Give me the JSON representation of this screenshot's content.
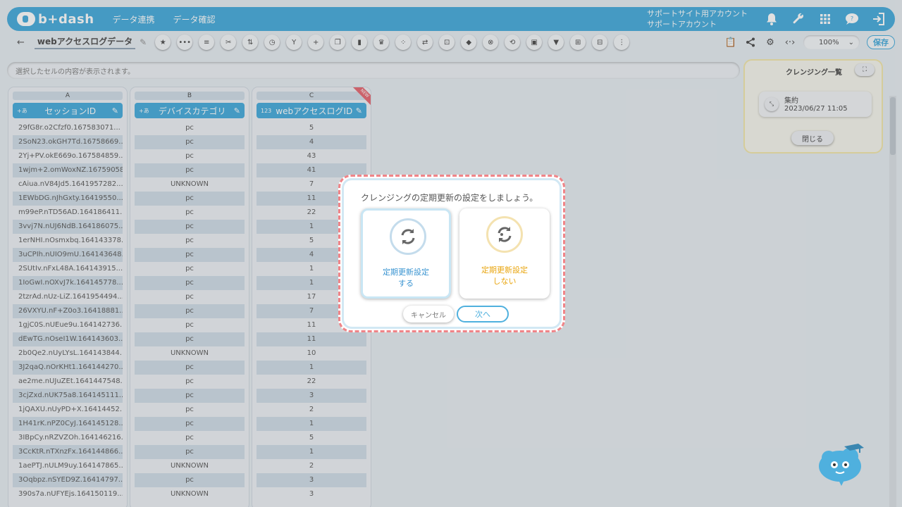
{
  "header": {
    "logo": "b+dash",
    "nav": [
      "データ連携",
      "データ確認"
    ],
    "account_line1": "サポートサイト用アカウント",
    "account_line2": "サポートアカウント",
    "icons": [
      "bell-icon",
      "wrench-icon",
      "grid-icon",
      "chat-icon",
      "logout-icon"
    ]
  },
  "toolbar": {
    "back": "←",
    "doc_name": "webアクセスログデータ",
    "tool_icons": [
      "star-icon",
      "dots-icon",
      "list-icon",
      "scissors-icon",
      "split-icon",
      "timer-icon",
      "merge-icon",
      "plus-icon",
      "copy-icon",
      "trash-icon",
      "crown-icon",
      "move-icon",
      "replace-icon",
      "lock-icon",
      "cube-icon",
      "cancel-circle-icon",
      "convert-icon",
      "frame-icon",
      "filter-icon",
      "pivot-icon",
      "table-icon",
      "column-icon"
    ],
    "zoom": "100%",
    "save": "保存"
  },
  "status": {
    "text": "選択したセルの内容が表示されます。"
  },
  "table": {
    "columns": [
      {
        "letter": "A",
        "type": "+あ",
        "name": "セッションID",
        "cells": [
          "29fG8r.o2Cfzf0.167583071...",
          "2SoN23.okGH7Td.16758669...",
          "2Yj+PV.okE669o.167584859...",
          "1wjm+2.omWoxNZ.16759058...",
          "cAiua.nV84Jd5.1641957282...",
          "1EWbDG.nJhGxty.16419550...",
          "m99eP.nTD56AD.164186411...",
          "3vvj7N.nUJ6NdB.164186075...",
          "1erNHI.nOsmxbq.164143378...",
          "3uCPIh.nUIO9mU.164143648...",
          "2SUtIv.nFxL48A.164143915...",
          "1IoGwI.nOXvJ7k.164145778...",
          "2tzrAd.nUz-LiZ.1641954494...",
          "26VXYU.nF+Z0o3.16418881...",
          "1gjC0S.nUEue9u.164142736...",
          "dEwTG.nOseI1W.164143603...",
          "2b0Qe2.nUyLYsL.164143844...",
          "3J2qaQ.nOrKHt1.164144270...",
          "ae2me.nUJuZEt.1641447548...",
          "3cjZxd.nUK75a8.164145111...",
          "1jQAXU.nUyPD+X.16414452...",
          "1H41rK.nPZ0CyJ.164145128...",
          "3IBpCy.nRZVZOh.164146216...",
          "3CcKtR.nTXnzFx.164144866...",
          "1aePTJ.nULM9uy.164147865...",
          "3Oqbpz.nSYED9Z.16414797...",
          "390s7a.nUFYEjs.164150119..."
        ]
      },
      {
        "letter": "B",
        "type": "+あ",
        "name": "デバイスカテゴリ",
        "cells": [
          "pc",
          "pc",
          "pc",
          "pc",
          "UNKNOWN",
          "pc",
          "pc",
          "pc",
          "pc",
          "pc",
          "pc",
          "pc",
          "pc",
          "pc",
          "pc",
          "pc",
          "UNKNOWN",
          "pc",
          "pc",
          "pc",
          "pc",
          "pc",
          "pc",
          "pc",
          "UNKNOWN",
          "pc",
          "UNKNOWN"
        ]
      },
      {
        "letter": "C",
        "type": "123",
        "name": "webアクセスログID(…",
        "badge": "NEW",
        "cells": [
          "5",
          "4",
          "43",
          "41",
          "7",
          "11",
          "22",
          "1",
          "5",
          "4",
          "1",
          "1",
          "17",
          "7",
          "11",
          "11",
          "10",
          "1",
          "22",
          "3",
          "2",
          "1",
          "5",
          "1",
          "2",
          "3",
          "3"
        ]
      }
    ]
  },
  "panel": {
    "title": "クレンジング一覧",
    "history_title": "集約",
    "history_date": "2023/06/27 11:05",
    "close": "閉じる"
  },
  "modal": {
    "question": "クレンジングの定期更新の設定をしましょう。",
    "option_yes_line1": "定期更新設定",
    "option_yes_line2": "する",
    "option_no_line1": "定期更新設定",
    "option_no_line2": "しない",
    "cancel": "キャンセル",
    "next": "次へ",
    "colors": {
      "accent": "#4fb0de",
      "yes": "#3a94d1",
      "no": "#e9a610",
      "dashed_border": "#f08488"
    }
  }
}
